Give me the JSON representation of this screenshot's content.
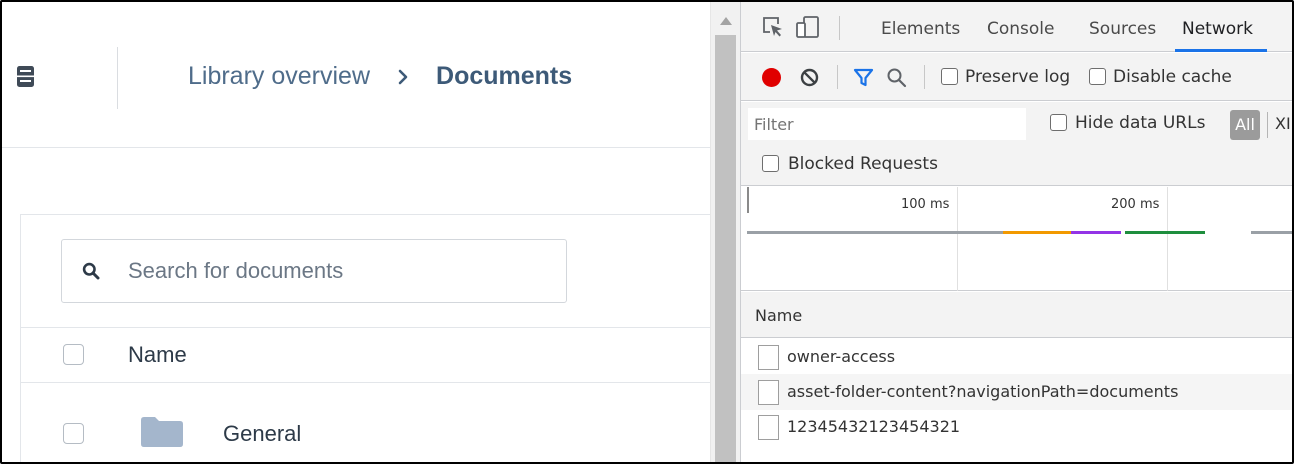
{
  "app": {
    "breadcrumb": {
      "parent": "Library overview",
      "separator": "›",
      "current": "Documents"
    },
    "search": {
      "placeholder": "Search for documents",
      "value": ""
    },
    "table": {
      "name_header": "Name",
      "rows": [
        {
          "name": "General",
          "type_icon": "folder-icon"
        }
      ]
    },
    "colors": {
      "breadcrumb_text": "#4f6c8a",
      "folder": "#a4b6cc"
    }
  },
  "devtools": {
    "tabs": [
      {
        "label": "Elements",
        "active": false
      },
      {
        "label": "Console",
        "active": false
      },
      {
        "label": "Sources",
        "active": false
      },
      {
        "label": "Network",
        "active": true
      }
    ],
    "toolbar": {
      "preserve_log_label": "Preserve log",
      "preserve_log_checked": false,
      "disable_cache_label": "Disable cache",
      "disable_cache_checked": false
    },
    "filter": {
      "placeholder": "Filter",
      "value": "",
      "hide_data_urls_label": "Hide data URLs",
      "hide_data_urls_checked": false,
      "all_label": "All",
      "xhr_label": "XI"
    },
    "blocked_requests_label": "Blocked Requests",
    "blocked_requests_checked": false,
    "timeline": {
      "ticks": [
        "100 ms",
        "200 ms"
      ]
    },
    "requests": {
      "name_header": "Name",
      "rows": [
        {
          "name": "owner-access"
        },
        {
          "name": "asset-folder-content?navigationPath=documents"
        },
        {
          "name": "12345432123454321"
        }
      ]
    },
    "colors": {
      "record": "#e00000",
      "active_tab_underline": "#1a73e8",
      "filter_icon": "#1a73e8",
      "timeline_orange": "#f29900",
      "timeline_purple": "#9334e6",
      "timeline_green": "#1e8e3e"
    }
  }
}
